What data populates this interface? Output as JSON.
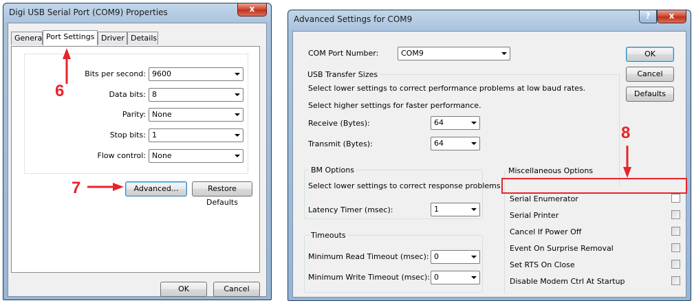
{
  "left_dialog": {
    "title": "Digi USB Serial Port (COM9) Properties",
    "tabs": [
      "General",
      "Port Settings",
      "Driver",
      "Details"
    ],
    "active_tab": "Port Settings",
    "fields": [
      {
        "label": "Bits per second:",
        "value": "9600"
      },
      {
        "label": "Data bits:",
        "value": "8"
      },
      {
        "label": "Parity:",
        "value": "None"
      },
      {
        "label": "Stop bits:",
        "value": "1"
      },
      {
        "label": "Flow control:",
        "value": "None"
      }
    ],
    "advanced_button": "Advanced...",
    "restore_defaults_button": "Restore Defaults",
    "ok_button": "OK",
    "cancel_button": "Cancel",
    "close_glyph": "x"
  },
  "right_dialog": {
    "title": "Advanced Settings for COM9",
    "help_glyph": "?",
    "close_glyph": "x",
    "com_port_label": "COM Port Number:",
    "com_port_value": "COM9",
    "ok_button": "OK",
    "cancel_button": "Cancel",
    "defaults_button": "Defaults",
    "usb_transfer": {
      "legend": "USB Transfer Sizes",
      "text_low": "Select lower settings to correct performance problems at low baud rates.",
      "text_high": "Select higher settings for faster performance.",
      "receive_label": "Receive (Bytes):",
      "receive_value": "64",
      "transmit_label": "Transmit (Bytes):",
      "transmit_value": "64"
    },
    "bm_options": {
      "legend": "BM Options",
      "text": "Select lower settings to correct response problems.",
      "latency_label": "Latency Timer (msec):",
      "latency_value": "1"
    },
    "timeouts": {
      "legend": "Timeouts",
      "read_label": "Minimum Read Timeout (msec):",
      "read_value": "0",
      "write_label": "Minimum Write Timeout (msec):",
      "write_value": "0"
    },
    "misc_options": {
      "legend": "Miscellaneous Options",
      "items": [
        {
          "label": "Serial Enumerator",
          "checked": false
        },
        {
          "label": "Serial Printer",
          "checked": false
        },
        {
          "label": "Cancel If Power Off",
          "checked": false
        },
        {
          "label": "Event On Surprise Removal",
          "checked": false
        },
        {
          "label": "Set RTS On Close",
          "checked": false
        },
        {
          "label": "Disable Modem Ctrl At Startup",
          "checked": false
        }
      ]
    }
  },
  "annotations": [
    "6",
    "7",
    "8"
  ],
  "colors": {
    "annotation": "#e8232a",
    "title_bar": "#a9c2dd"
  }
}
